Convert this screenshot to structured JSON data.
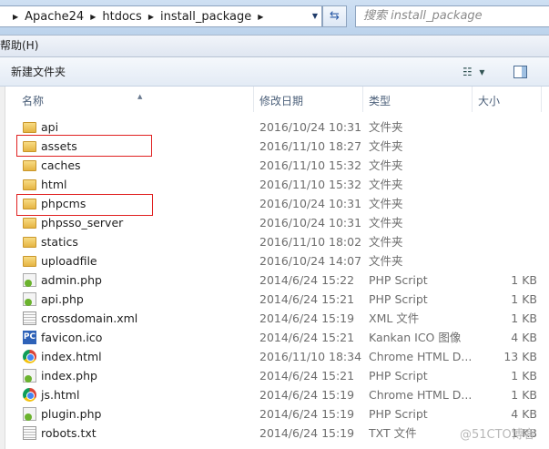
{
  "address": {
    "crumbs": [
      "Apache24",
      "htdocs",
      "install_package"
    ]
  },
  "search": {
    "placeholder": "搜索 install_package"
  },
  "menu": {
    "help": "帮助(H)"
  },
  "toolbar": {
    "new_folder": "新建文件夹",
    "view_icon": "view-list-icon",
    "pane_icon": "preview-pane-icon"
  },
  "columns": {
    "name": "名称",
    "date": "修改日期",
    "type": "类型",
    "size": "大小"
  },
  "files": [
    {
      "name": "api",
      "date": "2016/10/24 10:31",
      "type": "文件夹",
      "size": "",
      "icon": "folder"
    },
    {
      "name": "assets",
      "date": "2016/11/10 18:27",
      "type": "文件夹",
      "size": "",
      "icon": "folder",
      "highlighted": true
    },
    {
      "name": "caches",
      "date": "2016/11/10 15:32",
      "type": "文件夹",
      "size": "",
      "icon": "folder"
    },
    {
      "name": "html",
      "date": "2016/11/10 15:32",
      "type": "文件夹",
      "size": "",
      "icon": "folder"
    },
    {
      "name": "phpcms",
      "date": "2016/10/24 10:31",
      "type": "文件夹",
      "size": "",
      "icon": "folder",
      "highlighted": true
    },
    {
      "name": "phpsso_server",
      "date": "2016/10/24 10:31",
      "type": "文件夹",
      "size": "",
      "icon": "folder"
    },
    {
      "name": "statics",
      "date": "2016/11/10 18:02",
      "type": "文件夹",
      "size": "",
      "icon": "folder"
    },
    {
      "name": "uploadfile",
      "date": "2016/10/24 14:07",
      "type": "文件夹",
      "size": "",
      "icon": "folder"
    },
    {
      "name": "admin.php",
      "date": "2014/6/24 15:22",
      "type": "PHP Script",
      "size": "1 KB",
      "icon": "php"
    },
    {
      "name": "api.php",
      "date": "2014/6/24 15:21",
      "type": "PHP Script",
      "size": "1 KB",
      "icon": "php"
    },
    {
      "name": "crossdomain.xml",
      "date": "2014/6/24 15:19",
      "type": "XML 文件",
      "size": "1 KB",
      "icon": "doc"
    },
    {
      "name": "favicon.ico",
      "date": "2014/6/24 15:21",
      "type": "Kankan ICO 图像",
      "size": "4 KB",
      "icon": "ico"
    },
    {
      "name": "index.html",
      "date": "2016/11/10 18:34",
      "type": "Chrome HTML D...",
      "size": "13 KB",
      "icon": "chrome"
    },
    {
      "name": "index.php",
      "date": "2014/6/24 15:21",
      "type": "PHP Script",
      "size": "1 KB",
      "icon": "php"
    },
    {
      "name": "js.html",
      "date": "2014/6/24 15:19",
      "type": "Chrome HTML D...",
      "size": "1 KB",
      "icon": "chrome"
    },
    {
      "name": "plugin.php",
      "date": "2014/6/24 15:19",
      "type": "PHP Script",
      "size": "4 KB",
      "icon": "php"
    },
    {
      "name": "robots.txt",
      "date": "2014/6/24 15:19",
      "type": "TXT 文件",
      "size": "1 KB",
      "icon": "doc"
    }
  ],
  "watermark": "@51CTO博客",
  "highlight_color": "#e02020"
}
